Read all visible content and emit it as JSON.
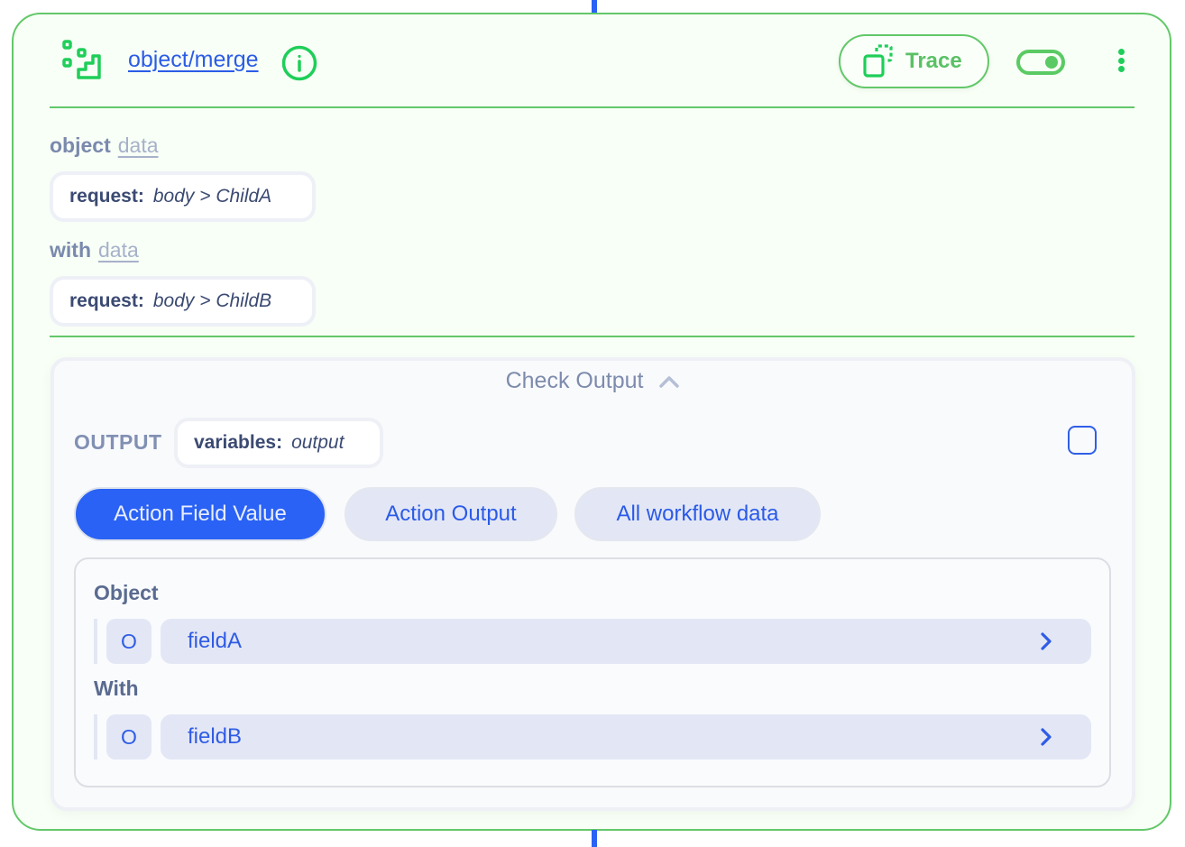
{
  "node": {
    "title": "object/merge",
    "icon": "steps-icon",
    "trace_label": "Trace",
    "enabled": true,
    "colors": {
      "border": "#62c869",
      "accent_green": "#1fce59",
      "link_blue": "#2b5ce6",
      "primary_blue": "#2962f4"
    }
  },
  "params": [
    {
      "label": "object",
      "link": "data",
      "value_key": "request:",
      "value_path": "body > ChildA"
    },
    {
      "label": "with",
      "link": "data",
      "value_key": "request:",
      "value_path": "body > ChildB"
    }
  ],
  "output_panel": {
    "toggle_label": "Check Output",
    "expanded": true,
    "output_label": "OUTPUT",
    "output_key": "variables:",
    "output_value": "output",
    "checkbox_checked": false,
    "tabs": [
      {
        "label": "Action Field Value",
        "active": true
      },
      {
        "label": "Action Output",
        "active": false
      },
      {
        "label": "All workflow data",
        "active": false
      }
    ],
    "groups": [
      {
        "label": "Object",
        "fields": [
          {
            "type": "O",
            "name": "fieldA"
          }
        ]
      },
      {
        "label": "With",
        "fields": [
          {
            "type": "O",
            "name": "fieldB"
          }
        ]
      }
    ]
  }
}
